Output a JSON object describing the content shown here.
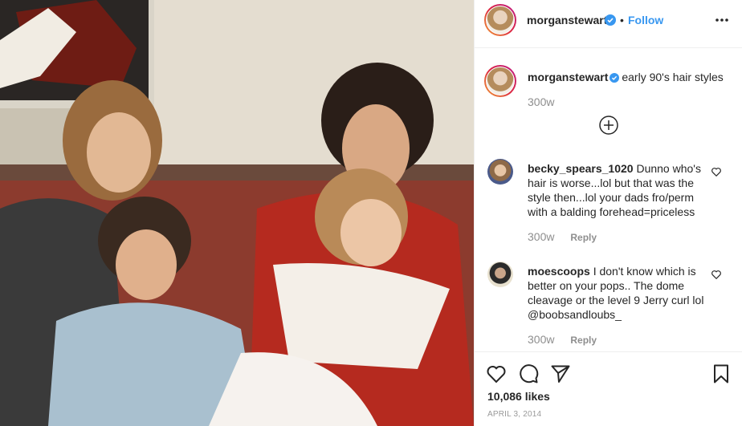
{
  "post": {
    "author": "morganstewart",
    "follow_label": "Follow",
    "separator": "•",
    "caption_text": "early 90's hair styles",
    "caption_age": "300w"
  },
  "comments": [
    {
      "username": "becky_spears_1020",
      "text": " Dunno who's hair is worse...lol but that was the style then...lol your dads fro/perm with a balding forehead=priceless",
      "age": "300w",
      "reply_label": "Reply"
    },
    {
      "username": "moescoops",
      "text": " I don't know which is better on your pops.. The dome cleavage or the level 9 Jerry curl lol @boobsandloubs_",
      "age": "300w",
      "reply_label": "Reply"
    }
  ],
  "footer": {
    "likes": "10,086 likes",
    "date": "April 3, 2014"
  },
  "colors": {
    "link_blue": "#3897f0",
    "verified_blue": "#3897f0",
    "muted": "#8e8e8e"
  },
  "icons": {
    "verified": "verified-badge-icon",
    "more": "more-options-icon",
    "load_more": "load-more-comments-icon",
    "like": "heart-icon",
    "comment": "comment-bubble-icon",
    "share": "paper-plane-icon",
    "save": "bookmark-icon"
  }
}
